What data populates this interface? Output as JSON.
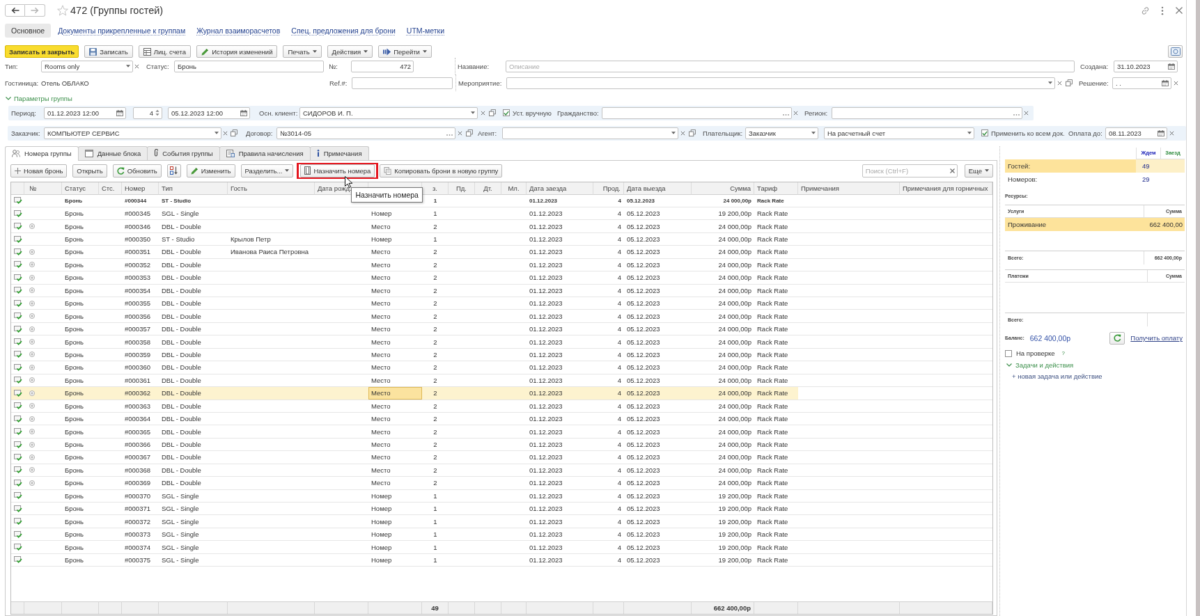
{
  "window": {
    "title": "472 (Группы гостей)",
    "favorite": false
  },
  "nav_buttons": [
    {
      "kind": "back",
      "disabled": false
    },
    {
      "kind": "forward",
      "disabled": true
    }
  ],
  "nav_tabs": [
    {
      "label": "Основное",
      "selected": true
    },
    {
      "label": "Документы прикрепленные к группам",
      "selected": false
    },
    {
      "label": "Журнал взаиморасчетов",
      "selected": false
    },
    {
      "label": "Спец. предложения для брони",
      "selected": false
    },
    {
      "label": "UTM-метки",
      "selected": false
    }
  ],
  "toolbar": {
    "buttons": [
      {
        "label": "Записать и закрыть",
        "kind": "primary"
      },
      {
        "label": "Записать",
        "kind": "save"
      },
      {
        "label": "Лиц. счета",
        "kind": "accounts"
      },
      {
        "label": "История изменений",
        "kind": "history"
      },
      {
        "label": "Печать",
        "kind": "dropdown"
      },
      {
        "label": "Действия",
        "kind": "dropdown"
      },
      {
        "label": "Перейти",
        "kind": "navigate"
      }
    ]
  },
  "header_fields": {
    "type": {
      "label": "Тип:",
      "value": "Rooms only"
    },
    "status": {
      "label": "Статус:",
      "value": "Бронь"
    },
    "number": {
      "label": "№:",
      "value": "472"
    },
    "name": {
      "label": "Название:",
      "placeholder": "Описание"
    },
    "created": {
      "label": "Создана:",
      "value": "31.10.2023"
    },
    "hotel": {
      "label": "Гостиница:",
      "value": "Отель ОБЛАКО"
    },
    "ref": {
      "label": "Ref.#:"
    },
    "event": {
      "label": "Мероприятие:"
    },
    "decision": {
      "label": "Решение:",
      "value": ". ."
    }
  },
  "group_params": {
    "title": "Параметры группы",
    "expanded": true,
    "period": {
      "label": "Период:",
      "start": "01.12.2023 12:00",
      "nights": "4",
      "end": "05.12.2023 12:00"
    },
    "main_client": {
      "label": "Осн. клиент:",
      "value": "СИДОРОВ И. П."
    },
    "manual": {
      "label": "Уст. вручную",
      "checked": true
    },
    "citizenship": {
      "label": "Гражданство:"
    },
    "region": {
      "label": "Регион:"
    }
  },
  "customer_row": {
    "customer": {
      "label": "Заказчик:",
      "value": "КОМПЬЮТЕР СЕРВИС"
    },
    "contract": {
      "label": "Договор:",
      "value": "№3014-05"
    },
    "agent": {
      "label": "Агент:"
    },
    "payer": {
      "label": "Плательщик:",
      "value": "Заказчик"
    },
    "payment_method": {
      "value": "На расчетный счет"
    },
    "apply_all": {
      "label": "Применить ко всем док.",
      "checked": true
    },
    "pay_by": {
      "label": "Оплата до:",
      "value": "08.11.2023"
    }
  },
  "tabs": [
    {
      "label": "Номера группы",
      "kind": "rooms",
      "selected": true
    },
    {
      "label": "Данные блока",
      "kind": "block",
      "selected": false
    },
    {
      "label": "События группы",
      "kind": "events",
      "selected": false
    },
    {
      "label": "Правила начисления",
      "kind": "rules",
      "selected": false
    },
    {
      "label": "Примечания",
      "kind": "notes",
      "selected": false
    }
  ],
  "table_toolbar": {
    "buttons": [
      {
        "label": "Новая бронь",
        "kind": "create",
        "highlighted": false
      },
      {
        "label": "Открыть",
        "kind": "plain",
        "highlighted": false
      },
      {
        "label": "Обновить",
        "kind": "refresh",
        "highlighted": false
      },
      {
        "kind": "sort",
        "highlighted": false
      },
      {
        "label": "Изменить",
        "kind": "edit",
        "highlighted": false
      },
      {
        "label": "Разделить...",
        "kind": "dropdown",
        "highlighted": false
      },
      {
        "label": "Назначить номера",
        "kind": "assign",
        "highlighted": true,
        "tooltip": "Назначить номера"
      },
      {
        "label": "Копировать брони в новую группу",
        "kind": "copy",
        "highlighted": false
      }
    ],
    "search": {
      "placeholder": "Поиск (Ctrl+F)"
    },
    "more": {
      "label": "Еще"
    }
  },
  "table": {
    "columns": [
      {
        "kind": "icon",
        "focused": false
      },
      {
        "label": "№",
        "kind": "tree",
        "focused": false
      },
      {
        "label": "Статус",
        "kind": "text",
        "focused": false
      },
      {
        "label": "Стс.",
        "kind": "text",
        "focused": false
      },
      {
        "label": "Номер",
        "kind": "text",
        "focused": false
      },
      {
        "label": "Тип",
        "kind": "text",
        "focused": false
      },
      {
        "label": "Гость",
        "kind": "text",
        "focused": false
      },
      {
        "label": "Дата рожд.",
        "kind": "text",
        "focused": false
      },
      {
        "kind": "text",
        "focused": true
      },
      {
        "label": "з.",
        "kind": "count",
        "focused": false
      },
      {
        "label": "Пд.",
        "kind": "count",
        "focused": false
      },
      {
        "label": "Дт.",
        "kind": "count",
        "focused": false
      },
      {
        "label": "Мл.",
        "kind": "count",
        "focused": false
      },
      {
        "label": "Дата заезда",
        "kind": "text",
        "focused": false
      },
      {
        "label": "Прод.",
        "kind": "number",
        "focused": false
      },
      {
        "label": "Дата выезда",
        "kind": "text",
        "focused": false
      },
      {
        "label": "Сумма",
        "kind": "number",
        "focused": false
      },
      {
        "label": "Тариф",
        "kind": "text",
        "focused": false
      },
      {
        "label": "Примечания",
        "kind": "note",
        "focused": false
      },
      {
        "label": "Примечания для горничных",
        "kind": "note",
        "focused": false
      }
    ],
    "rows": [
      {
        "status": "Бронь",
        "number": "#000344",
        "type": "ST - Studio",
        "persons": "1",
        "check_in": "01.12.2023",
        "nights": "4",
        "check_out": "05.12.2023",
        "sum": "24 000,00р",
        "rate": "Rack Rate",
        "expandable": false,
        "emphasized": true,
        "selected": false
      },
      {
        "status": "Бронь",
        "number": "#000345",
        "type": "SGL - Single",
        "accommodation": "Номер",
        "persons": "1",
        "check_in": "01.12.2023",
        "nights": "4",
        "check_out": "05.12.2023",
        "sum": "19 200,00р",
        "rate": "Rack Rate",
        "expandable": false,
        "emphasized": false,
        "selected": false
      },
      {
        "status": "Бронь",
        "number": "#000346",
        "type": "DBL - Double",
        "accommodation": "Место",
        "persons": "2",
        "check_in": "01.12.2023",
        "nights": "4",
        "check_out": "05.12.2023",
        "sum": "24 000,00р",
        "rate": "Rack Rate",
        "expandable": true,
        "emphasized": false,
        "selected": false
      },
      {
        "status": "Бронь",
        "number": "#000350",
        "type": "ST - Studio",
        "guest": "Крылов Петр",
        "accommodation": "Номер",
        "persons": "1",
        "check_in": "01.12.2023",
        "nights": "4",
        "check_out": "05.12.2023",
        "sum": "24 000,00р",
        "rate": "Rack Rate",
        "expandable": false,
        "emphasized": false,
        "selected": false
      },
      {
        "status": "Бронь",
        "number": "#000351",
        "type": "DBL - Double",
        "guest": "Иванова Раиса Петровна",
        "accommodation": "Место",
        "persons": "2",
        "check_in": "01.12.2023",
        "nights": "4",
        "check_out": "05.12.2023",
        "sum": "24 000,00р",
        "rate": "Rack Rate",
        "expandable": true,
        "emphasized": false,
        "selected": false
      },
      {
        "status": "Бронь",
        "number": "#000352",
        "type": "DBL - Double",
        "accommodation": "Место",
        "persons": "2",
        "check_in": "01.12.2023",
        "nights": "4",
        "check_out": "05.12.2023",
        "sum": "24 000,00р",
        "rate": "Rack Rate",
        "expandable": true,
        "emphasized": false,
        "selected": false
      },
      {
        "status": "Бронь",
        "number": "#000353",
        "type": "DBL - Double",
        "accommodation": "Место",
        "persons": "2",
        "check_in": "01.12.2023",
        "nights": "4",
        "check_out": "05.12.2023",
        "sum": "24 000,00р",
        "rate": "Rack Rate",
        "expandable": true,
        "emphasized": false,
        "selected": false
      },
      {
        "status": "Бронь",
        "number": "#000354",
        "type": "DBL - Double",
        "accommodation": "Место",
        "persons": "2",
        "check_in": "01.12.2023",
        "nights": "4",
        "check_out": "05.12.2023",
        "sum": "24 000,00р",
        "rate": "Rack Rate",
        "expandable": true,
        "emphasized": false,
        "selected": false
      },
      {
        "status": "Бронь",
        "number": "#000355",
        "type": "DBL - Double",
        "accommodation": "Место",
        "persons": "2",
        "check_in": "01.12.2023",
        "nights": "4",
        "check_out": "05.12.2023",
        "sum": "24 000,00р",
        "rate": "Rack Rate",
        "expandable": true,
        "emphasized": false,
        "selected": false
      },
      {
        "status": "Бронь",
        "number": "#000356",
        "type": "DBL - Double",
        "accommodation": "Место",
        "persons": "2",
        "check_in": "01.12.2023",
        "nights": "4",
        "check_out": "05.12.2023",
        "sum": "24 000,00р",
        "rate": "Rack Rate",
        "expandable": true,
        "emphasized": false,
        "selected": false
      },
      {
        "status": "Бронь",
        "number": "#000357",
        "type": "DBL - Double",
        "accommodation": "Место",
        "persons": "2",
        "check_in": "01.12.2023",
        "nights": "4",
        "check_out": "05.12.2023",
        "sum": "24 000,00р",
        "rate": "Rack Rate",
        "expandable": true,
        "emphasized": false,
        "selected": false
      },
      {
        "status": "Бронь",
        "number": "#000358",
        "type": "DBL - Double",
        "accommodation": "Место",
        "persons": "2",
        "check_in": "01.12.2023",
        "nights": "4",
        "check_out": "05.12.2023",
        "sum": "24 000,00р",
        "rate": "Rack Rate",
        "expandable": true,
        "emphasized": false,
        "selected": false
      },
      {
        "status": "Бронь",
        "number": "#000359",
        "type": "DBL - Double",
        "accommodation": "Место",
        "persons": "2",
        "check_in": "01.12.2023",
        "nights": "4",
        "check_out": "05.12.2023",
        "sum": "24 000,00р",
        "rate": "Rack Rate",
        "expandable": true,
        "emphasized": false,
        "selected": false
      },
      {
        "status": "Бронь",
        "number": "#000360",
        "type": "DBL - Double",
        "accommodation": "Место",
        "persons": "2",
        "check_in": "01.12.2023",
        "nights": "4",
        "check_out": "05.12.2023",
        "sum": "24 000,00р",
        "rate": "Rack Rate",
        "expandable": true,
        "emphasized": false,
        "selected": false
      },
      {
        "status": "Бронь",
        "number": "#000361",
        "type": "DBL - Double",
        "accommodation": "Место",
        "persons": "2",
        "check_in": "01.12.2023",
        "nights": "4",
        "check_out": "05.12.2023",
        "sum": "24 000,00р",
        "rate": "Rack Rate",
        "expandable": true,
        "emphasized": false,
        "selected": false
      },
      {
        "status": "Бронь",
        "number": "#000362",
        "type": "DBL - Double",
        "accommodation": "Место",
        "persons": "2",
        "check_in": "01.12.2023",
        "nights": "4",
        "check_out": "05.12.2023",
        "sum": "24 000,00р",
        "rate": "Rack Rate",
        "expandable": true,
        "emphasized": false,
        "selected": true
      },
      {
        "status": "Бронь",
        "number": "#000363",
        "type": "DBL - Double",
        "accommodation": "Место",
        "persons": "2",
        "check_in": "01.12.2023",
        "nights": "4",
        "check_out": "05.12.2023",
        "sum": "24 000,00р",
        "rate": "Rack Rate",
        "expandable": true,
        "emphasized": false,
        "selected": false
      },
      {
        "status": "Бронь",
        "number": "#000364",
        "type": "DBL - Double",
        "accommodation": "Место",
        "persons": "2",
        "check_in": "01.12.2023",
        "nights": "4",
        "check_out": "05.12.2023",
        "sum": "24 000,00р",
        "rate": "Rack Rate",
        "expandable": true,
        "emphasized": false,
        "selected": false
      },
      {
        "status": "Бронь",
        "number": "#000365",
        "type": "DBL - Double",
        "accommodation": "Место",
        "persons": "2",
        "check_in": "01.12.2023",
        "nights": "4",
        "check_out": "05.12.2023",
        "sum": "24 000,00р",
        "rate": "Rack Rate",
        "expandable": true,
        "emphasized": false,
        "selected": false
      },
      {
        "status": "Бронь",
        "number": "#000366",
        "type": "DBL - Double",
        "accommodation": "Место",
        "persons": "2",
        "check_in": "01.12.2023",
        "nights": "4",
        "check_out": "05.12.2023",
        "sum": "24 000,00р",
        "rate": "Rack Rate",
        "expandable": true,
        "emphasized": false,
        "selected": false
      },
      {
        "status": "Бронь",
        "number": "#000367",
        "type": "DBL - Double",
        "accommodation": "Место",
        "persons": "2",
        "check_in": "01.12.2023",
        "nights": "4",
        "check_out": "05.12.2023",
        "sum": "24 000,00р",
        "rate": "Rack Rate",
        "expandable": true,
        "emphasized": false,
        "selected": false
      },
      {
        "status": "Бронь",
        "number": "#000368",
        "type": "DBL - Double",
        "accommodation": "Место",
        "persons": "2",
        "check_in": "01.12.2023",
        "nights": "4",
        "check_out": "05.12.2023",
        "sum": "24 000,00р",
        "rate": "Rack Rate",
        "expandable": true,
        "emphasized": false,
        "selected": false
      },
      {
        "status": "Бронь",
        "number": "#000369",
        "type": "DBL - Double",
        "accommodation": "Место",
        "persons": "2",
        "check_in": "01.12.2023",
        "nights": "4",
        "check_out": "05.12.2023",
        "sum": "24 000,00р",
        "rate": "Rack Rate",
        "expandable": true,
        "emphasized": false,
        "selected": false
      },
      {
        "status": "Бронь",
        "number": "#000370",
        "type": "SGL - Single",
        "accommodation": "Номер",
        "persons": "1",
        "check_in": "01.12.2023",
        "nights": "4",
        "check_out": "05.12.2023",
        "sum": "19 200,00р",
        "rate": "Rack Rate",
        "expandable": false,
        "emphasized": false,
        "selected": false
      },
      {
        "status": "Бронь",
        "number": "#000371",
        "type": "SGL - Single",
        "accommodation": "Номер",
        "persons": "1",
        "check_in": "01.12.2023",
        "nights": "4",
        "check_out": "05.12.2023",
        "sum": "19 200,00р",
        "rate": "Rack Rate",
        "expandable": false,
        "emphasized": false,
        "selected": false
      },
      {
        "status": "Бронь",
        "number": "#000372",
        "type": "SGL - Single",
        "accommodation": "Номер",
        "persons": "1",
        "check_in": "01.12.2023",
        "nights": "4",
        "check_out": "05.12.2023",
        "sum": "19 200,00р",
        "rate": "Rack Rate",
        "expandable": false,
        "emphasized": false,
        "selected": false
      },
      {
        "status": "Бронь",
        "number": "#000373",
        "type": "SGL - Single",
        "accommodation": "Номер",
        "persons": "1",
        "check_in": "01.12.2023",
        "nights": "4",
        "check_out": "05.12.2023",
        "sum": "19 200,00р",
        "rate": "Rack Rate",
        "expandable": false,
        "emphasized": false,
        "selected": false
      },
      {
        "status": "Бронь",
        "number": "#000374",
        "type": "SGL - Single",
        "accommodation": "Номер",
        "persons": "1",
        "check_in": "01.12.2023",
        "nights": "4",
        "check_out": "05.12.2023",
        "sum": "19 200,00р",
        "rate": "Rack Rate",
        "expandable": false,
        "emphasized": false,
        "selected": false
      },
      {
        "status": "Бронь",
        "number": "#000375",
        "type": "SGL - Single",
        "accommodation": "Номер",
        "persons": "1",
        "check_in": "01.12.2023",
        "nights": "4",
        "check_out": "05.12.2023",
        "sum": "19 200,00р",
        "rate": "Rack Rate",
        "expandable": false,
        "emphasized": false,
        "selected": false
      }
    ],
    "totals": {
      "persons": "49",
      "sum": "662 400,00р"
    }
  },
  "right_panel": {
    "summary": {
      "columns": [
        {
          "label": "Ждем",
          "color": "#1c22b8"
        },
        {
          "label": "Заезд",
          "color": "#2e8b3e"
        }
      ],
      "rows": [
        {
          "label": "Гостей:",
          "value": "49",
          "selected": true
        },
        {
          "label": "Номеров:",
          "value": "29",
          "selected": false
        }
      ]
    },
    "resources": {
      "title": "Ресурсы:",
      "columns": [
        "Услуги",
        "Сумма"
      ],
      "rows": [
        {
          "service": "Проживание",
          "sum": "662 400,00",
          "selected": true
        }
      ],
      "total_label": "Всего:",
      "total": "662 400,00р"
    },
    "payments": {
      "columns": [
        "Платежи",
        "Сумма"
      ],
      "total_label": "Всего:"
    },
    "balance": {
      "label": "Баланс:",
      "value": "662 400,00р"
    },
    "get_payment": "Получить оплату",
    "review": {
      "label": "На проверке",
      "checked": false,
      "help": "?"
    },
    "tasks": {
      "title": "Задачи и действия",
      "expanded": true,
      "new_task": "+ новая задача или действие"
    }
  }
}
